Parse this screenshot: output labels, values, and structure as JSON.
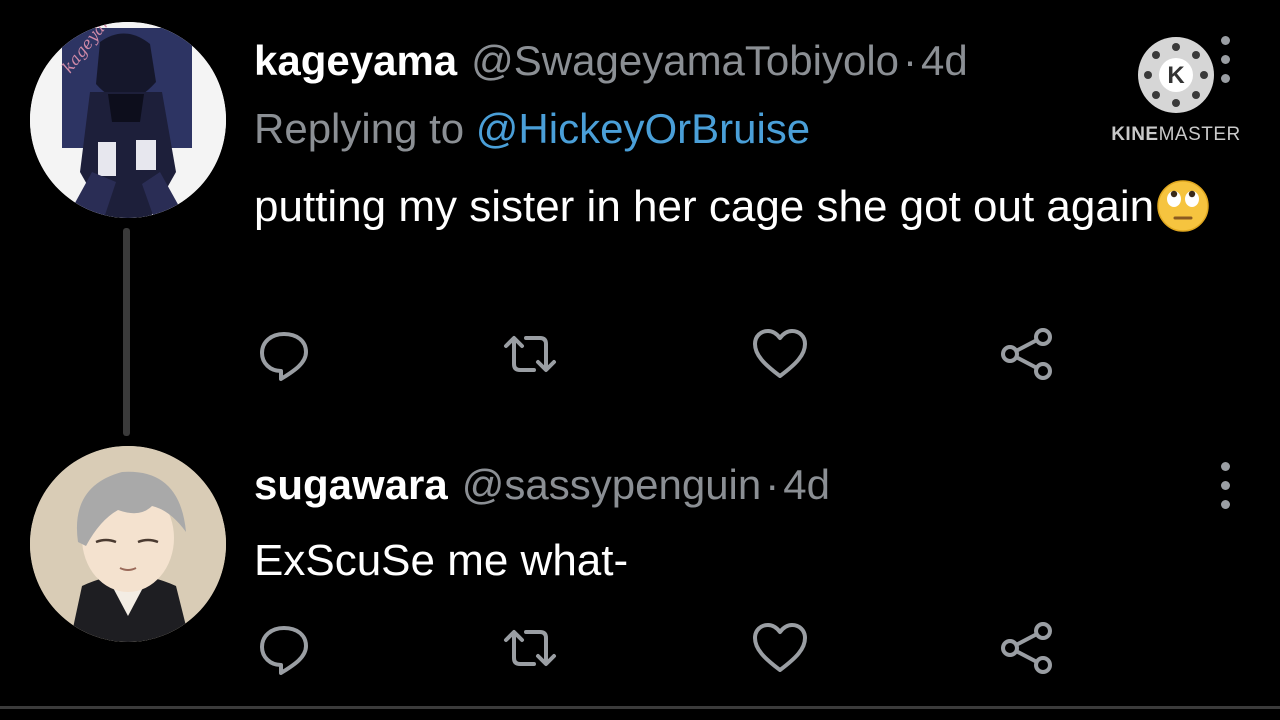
{
  "tweets": [
    {
      "display_name": "kageyama",
      "handle": "@SwageyamaTobiyolo",
      "separator": "·",
      "time": "4d",
      "replying_prefix": "Replying to ",
      "replying_to": "@HickeyOrBruise",
      "text": "putting my sister in her cage she got out again",
      "emoji": "face-with-rolling-eyes",
      "avatar_caption": "kageyama tobio"
    },
    {
      "display_name": "sugawara",
      "handle": "@sassypenguin",
      "separator": "·",
      "time": "4d",
      "text": "ExScuSe me what-"
    }
  ],
  "watermark": {
    "letter": "K",
    "brand_prefix": "KINE",
    "brand_suffix": "MASTER"
  },
  "icons": [
    "reply-icon",
    "retweet-icon",
    "like-icon",
    "share-icon",
    "more-options-icon"
  ],
  "colors": {
    "background": "#000000",
    "text_primary": "#ffffff",
    "text_secondary": "#8b8f94",
    "mention": "#4a9fd8",
    "icon": "#9a9ea3",
    "thread_line": "#3a3a3a"
  }
}
